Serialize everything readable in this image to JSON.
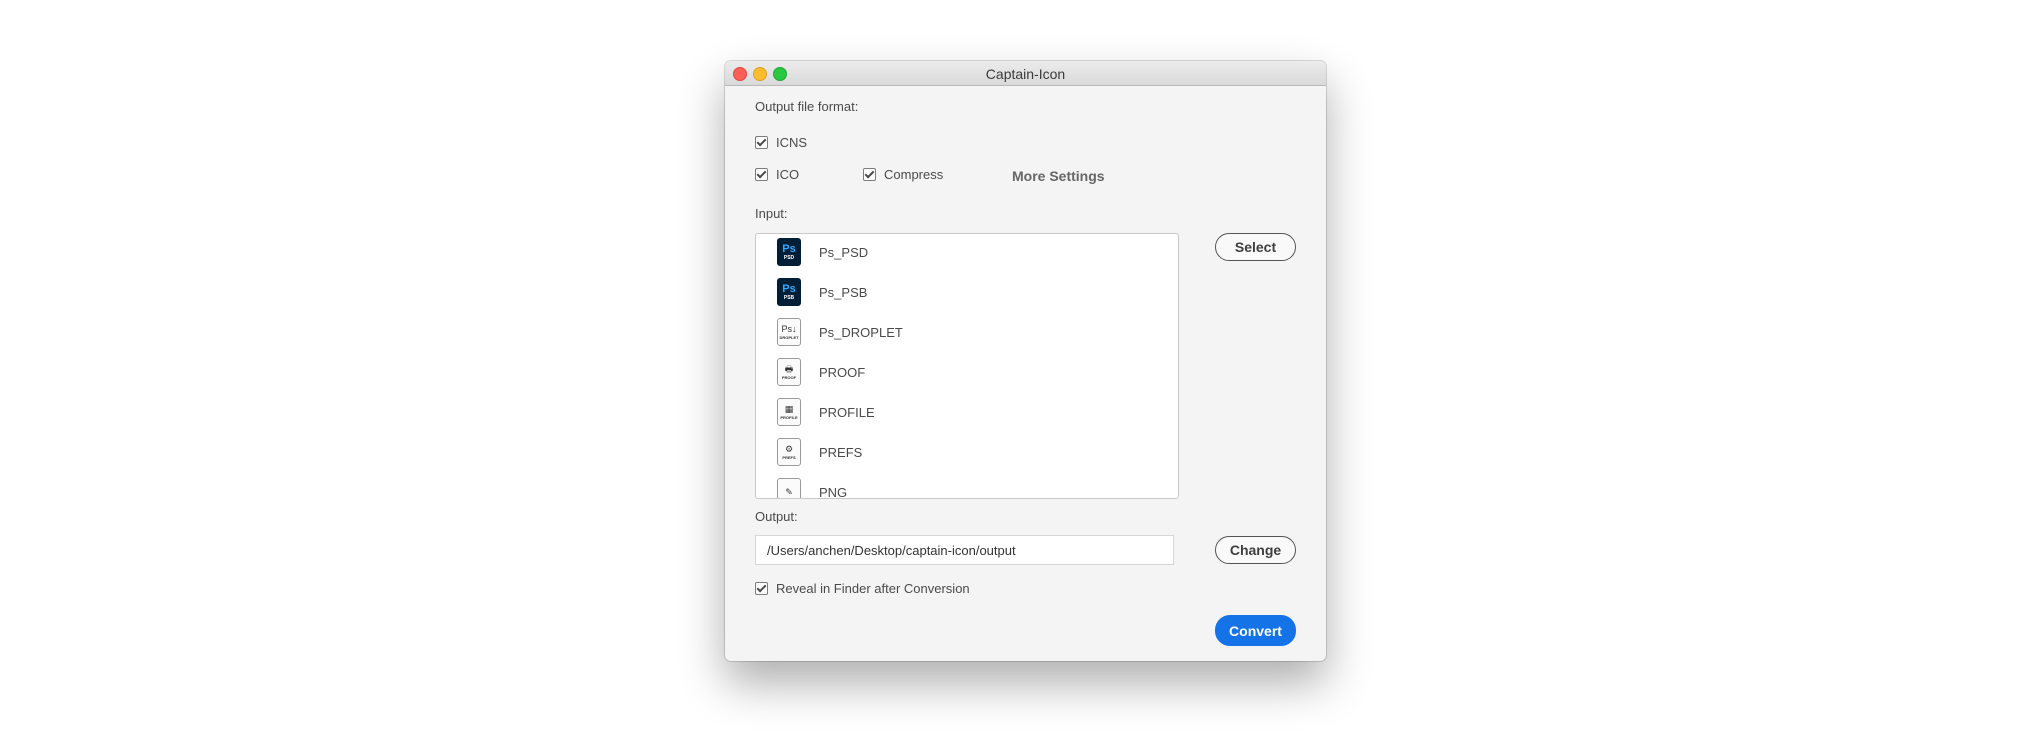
{
  "window": {
    "title": "Captain-Icon"
  },
  "format": {
    "label": "Output file format:",
    "icns": "ICNS",
    "ico": "ICO",
    "compress": "Compress",
    "more_settings": "More Settings"
  },
  "input": {
    "label": "Input:",
    "select_button": "Select",
    "items": [
      {
        "label": "Ps_PSD",
        "icon_text": "Ps",
        "icon_sub": "PSD"
      },
      {
        "label": "Ps_PSB",
        "icon_text": "Ps",
        "icon_sub": "PSB"
      },
      {
        "label": "Ps_DROPLET",
        "icon_text": "Ps↓",
        "icon_sub": "DROPLET"
      },
      {
        "label": "PROOF",
        "icon_text": "🖶",
        "icon_sub": "PROOF"
      },
      {
        "label": "PROFILE",
        "icon_text": "▦",
        "icon_sub": "PROFILE"
      },
      {
        "label": "PREFS",
        "icon_text": "⚙",
        "icon_sub": "PREFS"
      },
      {
        "label": "PNG",
        "icon_text": "✎",
        "icon_sub": ""
      }
    ]
  },
  "output": {
    "label": "Output:",
    "path": "/Users/anchen/Desktop/captain-icon/output",
    "change_button": "Change",
    "reveal": "Reveal in Finder after Conversion"
  },
  "actions": {
    "convert_button": "Convert"
  },
  "colors": {
    "accent": "#1473e6",
    "ps_bg": "#001e36",
    "ps_text": "#31a8ff"
  }
}
